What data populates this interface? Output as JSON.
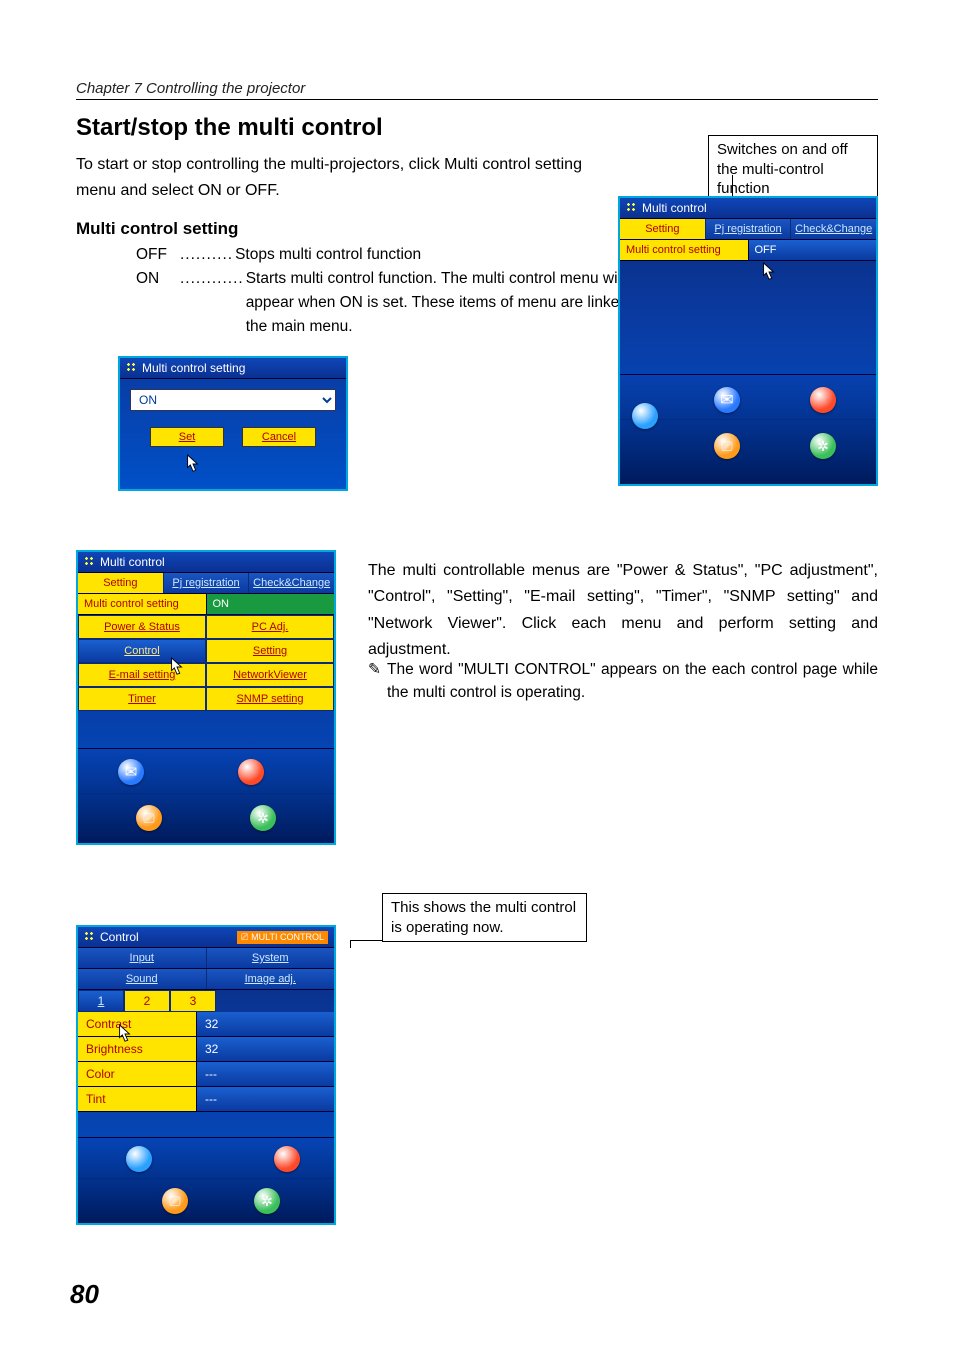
{
  "chapter": "Chapter 7 Controlling the projector",
  "heading": "Start/stop the multi control",
  "intro": "To start or stop controlling the multi-projectors, click  Multi control setting menu and select ON or OFF.",
  "subheading": "Multi control setting",
  "settings": {
    "off": {
      "key": "OFF",
      "dots": "..........",
      "desc": "Stops multi control function"
    },
    "on": {
      "key": "ON",
      "dots": "............",
      "desc": "Starts multi control function. The multi control menu will appear when ON is set. These items of menu are linked to the main menu."
    }
  },
  "callout_top": "Switches on and off the multi-control function",
  "callout_mid": "This shows the multi control is operating now.",
  "right_para": "The multi controllable menus are \"Power & Status\", \"PC adjustment\", \"Control\", \"Setting\", \"E-mail setting\", \"Timer\", \"SNMP setting\" and \"Network Viewer\". Click each menu and perform setting and adjustment.",
  "note": "The word \"MULTI CONTROL\" appears on the each control page while the multi control is operating.",
  "page_number": "80",
  "shot1": {
    "title": "Multi control",
    "tabs": [
      "Setting",
      "Pj registration",
      "Check&Change"
    ],
    "row_label": "Multi control setting",
    "row_value": "OFF"
  },
  "shotA": {
    "title": "Multi control setting",
    "value": "ON",
    "set": "Set",
    "cancel": "Cancel"
  },
  "shot2": {
    "title": "Multi control",
    "tabs": [
      "Setting",
      "Pj registration",
      "Check&Change"
    ],
    "row_label": "Multi control setting",
    "row_value": "ON",
    "menus": [
      "Power & Status",
      "PC Adj.",
      "Control",
      "Setting",
      "E-mail setting",
      "NetworkViewer",
      "Timer",
      "SNMP setting"
    ]
  },
  "shot3": {
    "title": "Control",
    "badge": "MULTI CONTROL",
    "tabs": [
      "Input",
      "System",
      "Sound",
      "Image adj."
    ],
    "numtabs": [
      "1",
      "2",
      "3"
    ],
    "rows": [
      {
        "k": "Contrast",
        "v": "32"
      },
      {
        "k": "Brightness",
        "v": "32"
      },
      {
        "k": "Color",
        "v": "---"
      },
      {
        "k": "Tint",
        "v": "---"
      }
    ]
  }
}
